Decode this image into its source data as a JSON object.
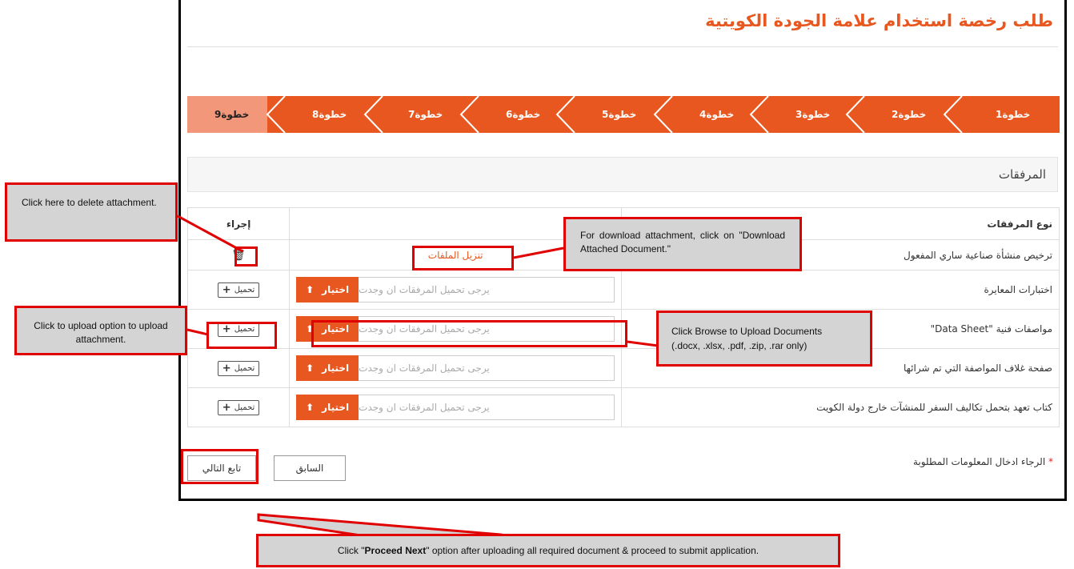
{
  "page_title": "طلب رخصة استخدام علامة الجودة الكويتية",
  "steps": [
    "خطوة1",
    "خطوة2",
    "خطوة3",
    "خطوة4",
    "خطوة5",
    "خطوة6",
    "خطوة7",
    "خطوة8",
    "خطوة9"
  ],
  "current_step": "خطوة9",
  "section_title": "المرفقات",
  "table": {
    "headers": {
      "type": "نوع المرفقات",
      "action": "إجراء"
    },
    "rows": [
      {
        "type": "ترخيص منشأة صناعية ساري المفعول",
        "download_label": "تنزيل الملفات"
      },
      {
        "type": "اختبارات المعايرة",
        "placeholder": "يرجى تحميل المرفقات ان وجدت",
        "browse_label": "اختيار",
        "upload_label": "تحميل"
      },
      {
        "type": "مواصفات فنية \"Data Sheet\"",
        "placeholder": "يرجى تحميل المرفقات ان وجدت",
        "browse_label": "اختيار",
        "upload_label": "تحميل"
      },
      {
        "type": "صفحة غلاف المواصفة التي تم شرائها",
        "placeholder": "يرجى تحميل المرفقات ان وجدت",
        "browse_label": "اختيار",
        "upload_label": "تحميل"
      },
      {
        "type": "كتاب تعهد بتحمل تكاليف السفر للمنشآت خارج دولة الكويت",
        "placeholder": "يرجى تحميل المرفقات ان وجدت",
        "browse_label": "اختيار",
        "upload_label": "تحميل"
      }
    ]
  },
  "required_note": "الرجاء ادخال المعلومات المطلوبة",
  "required_star": "*",
  "buttons": {
    "previous": "السابق",
    "next": "تابع التالي"
  },
  "callouts": {
    "delete": "Click here to delete attachment.",
    "download": "For download attachment, click on \"Download Attached Document.\"",
    "upload": "Click to upload option to upload attachment.",
    "browse_line1": "Click Browse to Upload Documents",
    "browse_line2": "(.docx, .xlsx, .pdf, .zip, .rar only)",
    "next_pre": "Click \"",
    "next_bold": "Proceed Next",
    "next_post": "\" option after uploading all required document & proceed to submit application."
  },
  "colors": {
    "accent": "#e8571f",
    "current_step": "#f2977a",
    "annotation": "#e00000",
    "callout_bg": "#d4d4d4"
  }
}
